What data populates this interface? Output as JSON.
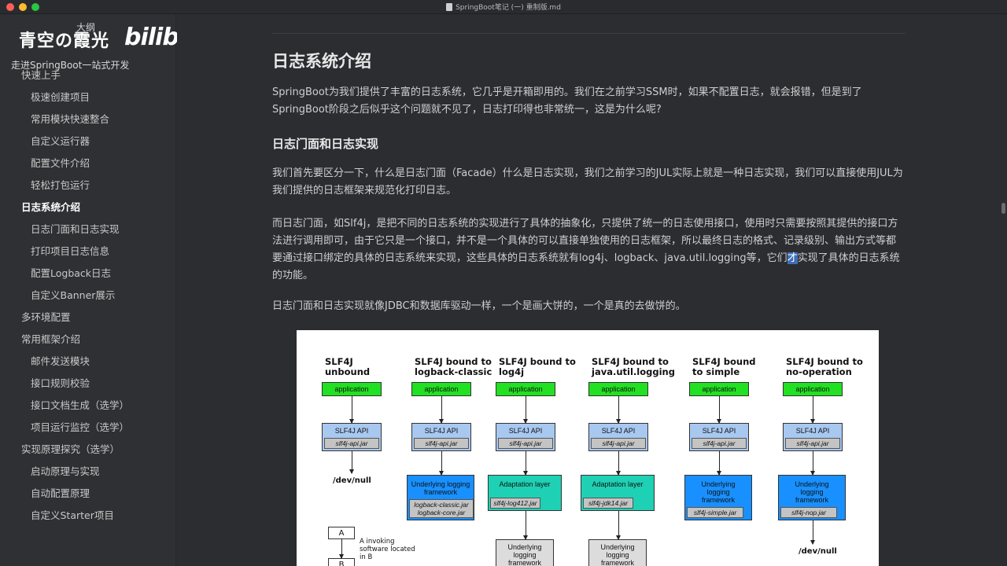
{
  "window": {
    "title": "SpringBoot笔记 (一) 重制版.md"
  },
  "brand": {
    "name": "青空の霞光",
    "outline_label": "大纲",
    "subtitle": "走进SpringBoot一站式开发",
    "watermark": "bilibili"
  },
  "toc": [
    {
      "label": "快速上手",
      "level": 1,
      "active": false
    },
    {
      "label": "极速创建项目",
      "level": 2,
      "active": false
    },
    {
      "label": "常用模块快速整合",
      "level": 2,
      "active": false
    },
    {
      "label": "自定义运行器",
      "level": 2,
      "active": false
    },
    {
      "label": "配置文件介绍",
      "level": 2,
      "active": false
    },
    {
      "label": "轻松打包运行",
      "level": 2,
      "active": false
    },
    {
      "label": "日志系统介绍",
      "level": 1,
      "active": true
    },
    {
      "label": "日志门面和日志实现",
      "level": 2,
      "active": false
    },
    {
      "label": "打印项目日志信息",
      "level": 2,
      "active": false
    },
    {
      "label": "配置Logback日志",
      "level": 2,
      "active": false
    },
    {
      "label": "自定义Banner展示",
      "level": 2,
      "active": false
    },
    {
      "label": "多环境配置",
      "level": 1,
      "active": false
    },
    {
      "label": "常用框架介绍",
      "level": 1,
      "active": false
    },
    {
      "label": "邮件发送模块",
      "level": 2,
      "active": false
    },
    {
      "label": "接口规则校验",
      "level": 2,
      "active": false
    },
    {
      "label": "接口文档生成（选学）",
      "level": 2,
      "active": false
    },
    {
      "label": "项目运行监控（选学）",
      "level": 2,
      "active": false
    },
    {
      "label": "实现原理探究（选学）",
      "level": 1,
      "active": false
    },
    {
      "label": "启动原理与实现",
      "level": 2,
      "active": false
    },
    {
      "label": "自动配置原理",
      "level": 2,
      "active": false
    },
    {
      "label": "自定义Starter项目",
      "level": 2,
      "active": false
    }
  ],
  "doc": {
    "h2": "日志系统介绍",
    "p1": "SpringBoot为我们提供了丰富的日志系统，它几乎是开箱即用的。我们在之前学习SSM时，如果不配置日志，就会报错，但是到了SpringBoot阶段之后似乎这个问题就不见了，日志打印得也非常统一，这是为什么呢?",
    "h3": "日志门面和日志实现",
    "p2": "我们首先要区分一下，什么是日志门面（Facade）什么是日志实现，我们之前学习的JUL实际上就是一种日志实现，我们可以直接使用JUL为我们提供的日志框架来规范化打印日志。",
    "p3_before": "而日志门面，如Slf4j，是把不同的日志系统的实现进行了具体的抽象化，只提供了统一的日志使用接口，使用时只需要按照其提供的接口方法进行调用即可，由于它只是一个接口，并不是一个具体的可以直接单独使用的日志框架，所以最终日志的格式、记录级别、输出方式等都要通过接口绑定的具体的日志系统来实现，这些具体的日志系统就有log4j、logback、java.util.logging等，它们",
    "p3_highlight": "才",
    "p3_after": "实现了具体的日志系统的功能。",
    "p4": "日志门面和日志实现就像JDBC和数据库驱动一样，一个是画大饼的，一个是真的去做饼的。"
  },
  "diagram": {
    "columns": [
      {
        "title": "SLF4J\nunbound",
        "app": "application",
        "api": "SLF4J API",
        "api_jar": "slf4j-api.jar",
        "end": "/dev/null"
      },
      {
        "title": "SLF4J bound to\nlogback-classic",
        "app": "application",
        "api": "SLF4J API",
        "api_jar": "slf4j-api.jar",
        "fw": "Underlying logging\nframework",
        "fw_jar": "logback-classic.jar\nlogback-core.jar"
      },
      {
        "title": "SLF4J bound to\nlog4j",
        "app": "application",
        "api": "SLF4J API",
        "api_jar": "slf4j-api.jar",
        "adapt": "Adaptation layer",
        "adapt_jar": "slf4j-log412.jar",
        "under": "Underlying\nlogging\nframework"
      },
      {
        "title": "SLF4J bound to\njava.util.logging",
        "app": "application",
        "api": "SLF4J API",
        "api_jar": "slf4j-api.jar",
        "adapt": "Adaptation layer",
        "adapt_jar": "slf4j-jdk14.jar",
        "under": "Underlying\nlogging\nframework"
      },
      {
        "title": "SLF4J bound\nto simple",
        "app": "application",
        "api": "SLF4J API",
        "api_jar": "slf4j-api.jar",
        "fw": "Underlying\nlogging\nframework",
        "fw_jar": "slf4j-simple.jar"
      },
      {
        "title": "SLF4J bound to\nno-operation",
        "app": "application",
        "api": "SLF4J API",
        "api_jar": "slf4j-api.jar",
        "fw": "Underlying\nlogging\nframework",
        "fw_jar": "slf4j-nop.jar",
        "end": "/dev/null"
      }
    ],
    "legend": {
      "a": "A",
      "b": "B",
      "text": "A invoking software located in B"
    }
  }
}
